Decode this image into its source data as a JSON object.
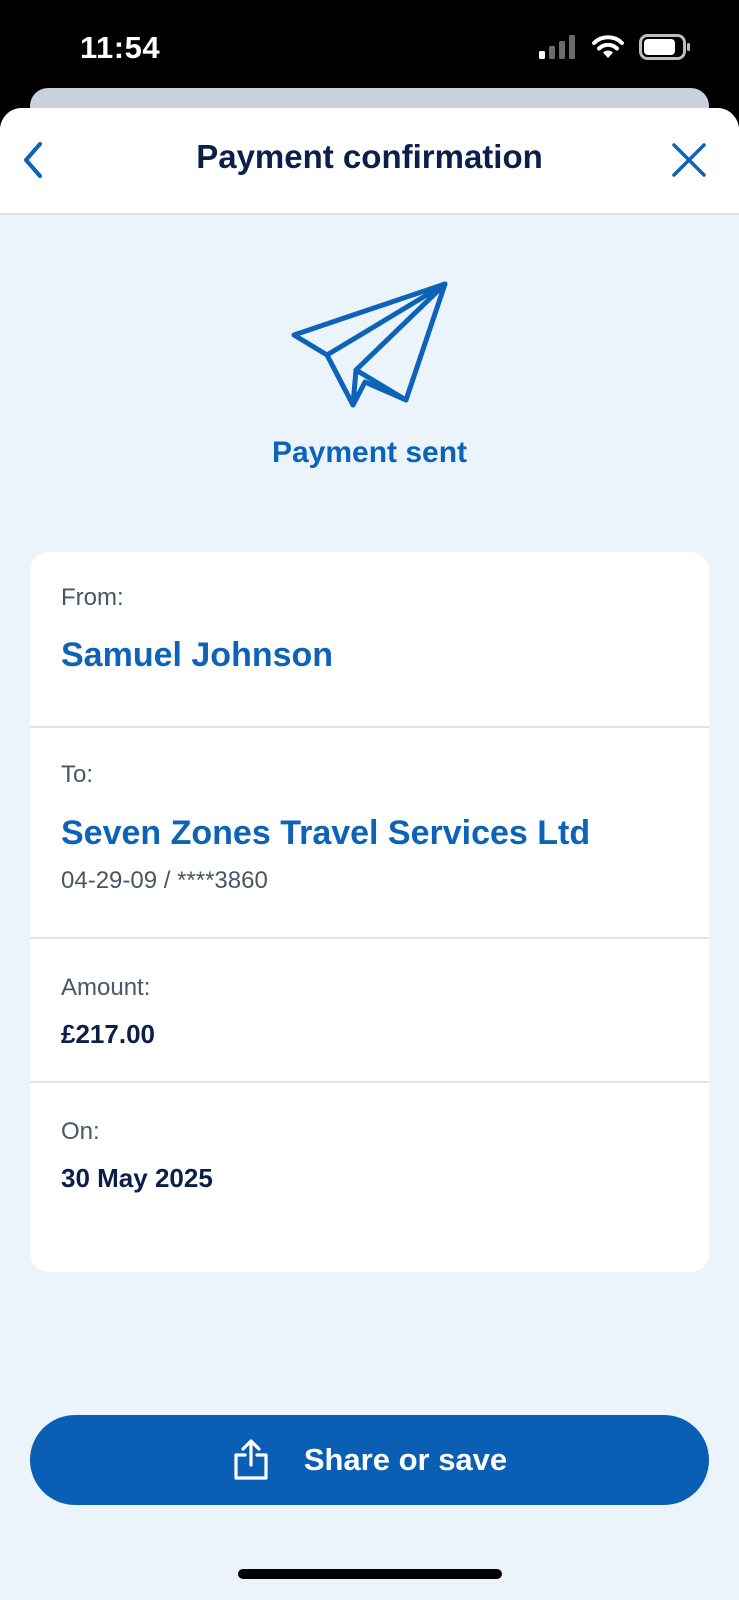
{
  "status_bar": {
    "time": "11:54",
    "icons": [
      "cellular-signal-icon",
      "wifi-icon",
      "battery-icon"
    ]
  },
  "nav": {
    "title": "Payment confirmation",
    "back_icon": "chevron-left-icon",
    "close_icon": "close-icon"
  },
  "hero": {
    "icon": "paper-plane-icon",
    "text": "Payment sent"
  },
  "details": {
    "from_label": "From:",
    "from_value": "Samuel Johnson",
    "to_label": "To:",
    "to_value": "Seven Zones Travel Services Ltd",
    "to_account": "04-29-09 / ****3860",
    "amount_label": "Amount:",
    "amount_value": "£217.00",
    "date_label": "On:",
    "date_value": "30 May 2025"
  },
  "share_button": {
    "label": "Share or save",
    "icon": "share-icon"
  },
  "colors": {
    "accent": "#0a5fb4",
    "title": "#0b1f4a",
    "background": "#ebf3fb"
  }
}
